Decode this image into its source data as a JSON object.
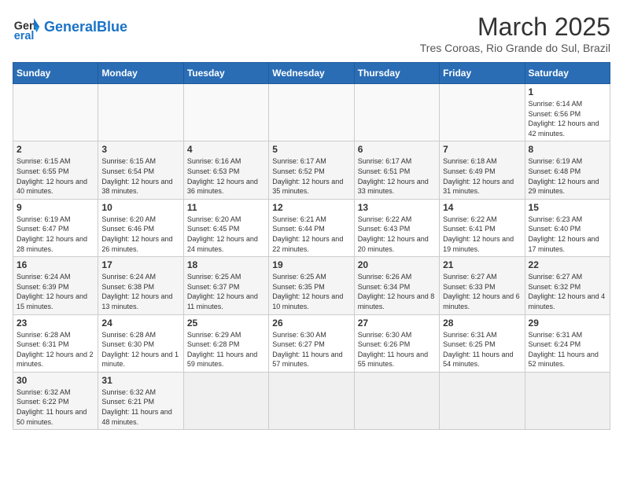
{
  "header": {
    "logo_general": "General",
    "logo_blue": "Blue",
    "month_title": "March 2025",
    "location": "Tres Coroas, Rio Grande do Sul, Brazil"
  },
  "weekdays": [
    "Sunday",
    "Monday",
    "Tuesday",
    "Wednesday",
    "Thursday",
    "Friday",
    "Saturday"
  ],
  "weeks": [
    [
      {
        "day": "",
        "info": ""
      },
      {
        "day": "",
        "info": ""
      },
      {
        "day": "",
        "info": ""
      },
      {
        "day": "",
        "info": ""
      },
      {
        "day": "",
        "info": ""
      },
      {
        "day": "",
        "info": ""
      },
      {
        "day": "1",
        "info": "Sunrise: 6:14 AM\nSunset: 6:56 PM\nDaylight: 12 hours and 42 minutes."
      }
    ],
    [
      {
        "day": "2",
        "info": "Sunrise: 6:15 AM\nSunset: 6:55 PM\nDaylight: 12 hours and 40 minutes."
      },
      {
        "day": "3",
        "info": "Sunrise: 6:15 AM\nSunset: 6:54 PM\nDaylight: 12 hours and 38 minutes."
      },
      {
        "day": "4",
        "info": "Sunrise: 6:16 AM\nSunset: 6:53 PM\nDaylight: 12 hours and 36 minutes."
      },
      {
        "day": "5",
        "info": "Sunrise: 6:17 AM\nSunset: 6:52 PM\nDaylight: 12 hours and 35 minutes."
      },
      {
        "day": "6",
        "info": "Sunrise: 6:17 AM\nSunset: 6:51 PM\nDaylight: 12 hours and 33 minutes."
      },
      {
        "day": "7",
        "info": "Sunrise: 6:18 AM\nSunset: 6:49 PM\nDaylight: 12 hours and 31 minutes."
      },
      {
        "day": "8",
        "info": "Sunrise: 6:19 AM\nSunset: 6:48 PM\nDaylight: 12 hours and 29 minutes."
      }
    ],
    [
      {
        "day": "9",
        "info": "Sunrise: 6:19 AM\nSunset: 6:47 PM\nDaylight: 12 hours and 28 minutes."
      },
      {
        "day": "10",
        "info": "Sunrise: 6:20 AM\nSunset: 6:46 PM\nDaylight: 12 hours and 26 minutes."
      },
      {
        "day": "11",
        "info": "Sunrise: 6:20 AM\nSunset: 6:45 PM\nDaylight: 12 hours and 24 minutes."
      },
      {
        "day": "12",
        "info": "Sunrise: 6:21 AM\nSunset: 6:44 PM\nDaylight: 12 hours and 22 minutes."
      },
      {
        "day": "13",
        "info": "Sunrise: 6:22 AM\nSunset: 6:43 PM\nDaylight: 12 hours and 20 minutes."
      },
      {
        "day": "14",
        "info": "Sunrise: 6:22 AM\nSunset: 6:41 PM\nDaylight: 12 hours and 19 minutes."
      },
      {
        "day": "15",
        "info": "Sunrise: 6:23 AM\nSunset: 6:40 PM\nDaylight: 12 hours and 17 minutes."
      }
    ],
    [
      {
        "day": "16",
        "info": "Sunrise: 6:24 AM\nSunset: 6:39 PM\nDaylight: 12 hours and 15 minutes."
      },
      {
        "day": "17",
        "info": "Sunrise: 6:24 AM\nSunset: 6:38 PM\nDaylight: 12 hours and 13 minutes."
      },
      {
        "day": "18",
        "info": "Sunrise: 6:25 AM\nSunset: 6:37 PM\nDaylight: 12 hours and 11 minutes."
      },
      {
        "day": "19",
        "info": "Sunrise: 6:25 AM\nSunset: 6:35 PM\nDaylight: 12 hours and 10 minutes."
      },
      {
        "day": "20",
        "info": "Sunrise: 6:26 AM\nSunset: 6:34 PM\nDaylight: 12 hours and 8 minutes."
      },
      {
        "day": "21",
        "info": "Sunrise: 6:27 AM\nSunset: 6:33 PM\nDaylight: 12 hours and 6 minutes."
      },
      {
        "day": "22",
        "info": "Sunrise: 6:27 AM\nSunset: 6:32 PM\nDaylight: 12 hours and 4 minutes."
      }
    ],
    [
      {
        "day": "23",
        "info": "Sunrise: 6:28 AM\nSunset: 6:31 PM\nDaylight: 12 hours and 2 minutes."
      },
      {
        "day": "24",
        "info": "Sunrise: 6:28 AM\nSunset: 6:30 PM\nDaylight: 12 hours and 1 minute."
      },
      {
        "day": "25",
        "info": "Sunrise: 6:29 AM\nSunset: 6:28 PM\nDaylight: 11 hours and 59 minutes."
      },
      {
        "day": "26",
        "info": "Sunrise: 6:30 AM\nSunset: 6:27 PM\nDaylight: 11 hours and 57 minutes."
      },
      {
        "day": "27",
        "info": "Sunrise: 6:30 AM\nSunset: 6:26 PM\nDaylight: 11 hours and 55 minutes."
      },
      {
        "day": "28",
        "info": "Sunrise: 6:31 AM\nSunset: 6:25 PM\nDaylight: 11 hours and 54 minutes."
      },
      {
        "day": "29",
        "info": "Sunrise: 6:31 AM\nSunset: 6:24 PM\nDaylight: 11 hours and 52 minutes."
      }
    ],
    [
      {
        "day": "30",
        "info": "Sunrise: 6:32 AM\nSunset: 6:22 PM\nDaylight: 11 hours and 50 minutes."
      },
      {
        "day": "31",
        "info": "Sunrise: 6:32 AM\nSunset: 6:21 PM\nDaylight: 11 hours and 48 minutes."
      },
      {
        "day": "",
        "info": ""
      },
      {
        "day": "",
        "info": ""
      },
      {
        "day": "",
        "info": ""
      },
      {
        "day": "",
        "info": ""
      },
      {
        "day": "",
        "info": ""
      }
    ]
  ]
}
